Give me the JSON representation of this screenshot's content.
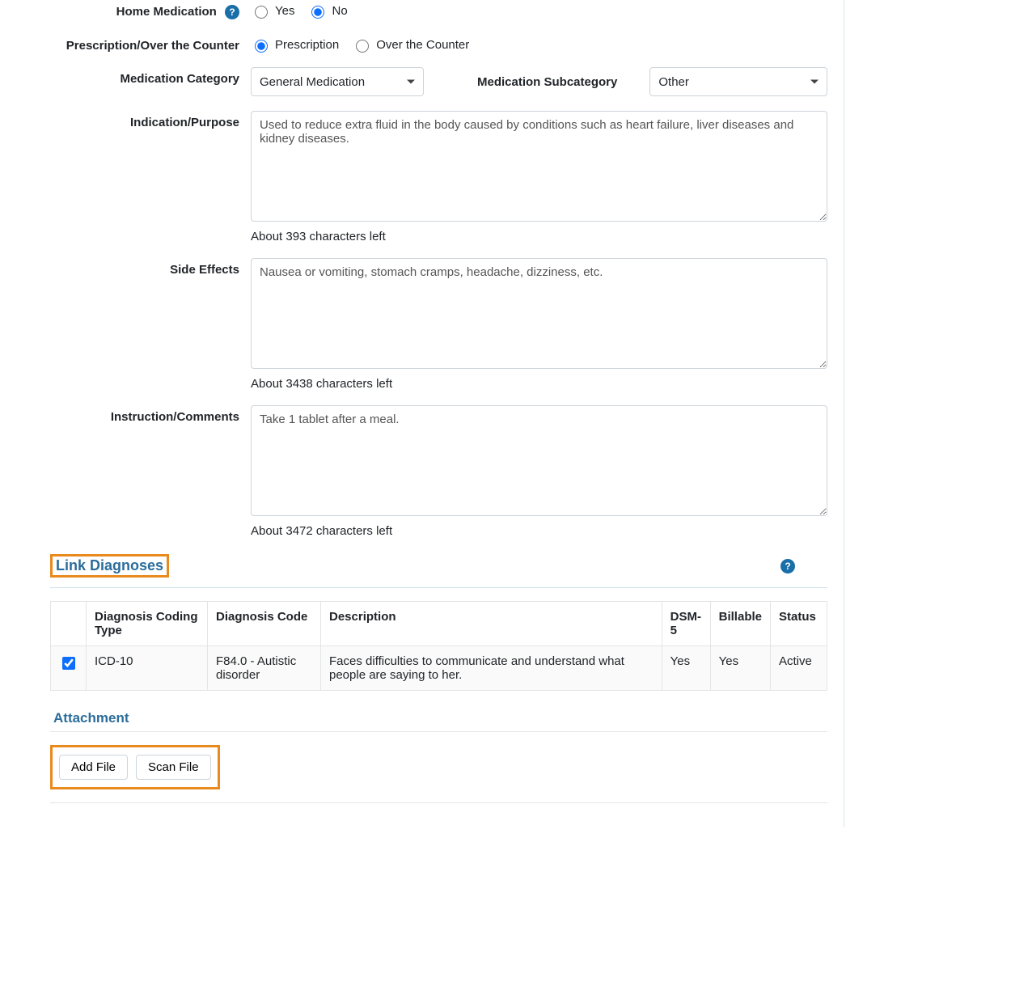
{
  "labels": {
    "home_medication": "Home Medication",
    "presc_otc": "Prescription/Over the Counter",
    "med_category": "Medication Category",
    "med_subcategory": "Medication Subcategory",
    "indication": "Indication/Purpose",
    "side_effects": "Side Effects",
    "instruction": "Instruction/Comments",
    "link_diag": "Link Diagnoses",
    "attachment": "Attachment"
  },
  "radios": {
    "hm_yes": "Yes",
    "hm_no": "No",
    "presc": "Prescription",
    "otc": "Over the Counter"
  },
  "selects": {
    "category": "General Medication",
    "subcategory": "Other"
  },
  "textareas": {
    "indication": "Used to reduce extra fluid in the body caused by conditions such as heart failure, liver diseases and kidney diseases.",
    "indication_count": "About 393 characters left",
    "side_effects": "Nausea or vomiting, stomach cramps, headache, dizziness, etc.",
    "side_effects_count": "About 3438 characters left",
    "instruction": "Take 1 tablet after a meal.",
    "instruction_count": "About 3472 characters left"
  },
  "table": {
    "headers": {
      "coding_type": "Diagnosis Coding Type",
      "code": "Diagnosis Code",
      "desc": "Description",
      "dsm5": "DSM-5",
      "billable": "Billable",
      "status": "Status"
    },
    "row": {
      "coding_type": "ICD-10",
      "code": "F84.0 - Autistic disorder",
      "desc": "Faces difficulties to communicate and understand what people are saying to her.",
      "dsm5": "Yes",
      "billable": "Yes",
      "status": "Active"
    }
  },
  "buttons": {
    "add_file": "Add File",
    "scan_file": "Scan File"
  },
  "icons": {
    "help": "?"
  }
}
